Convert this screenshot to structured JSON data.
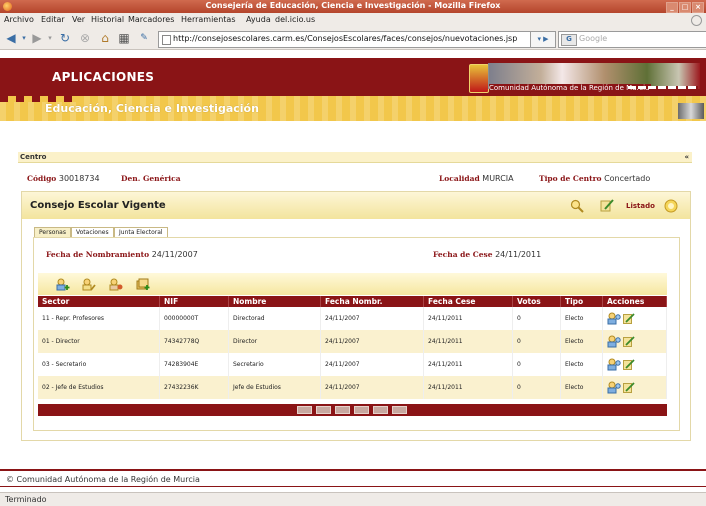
{
  "browser": {
    "title": "Consejería de Educación, Ciencia e Investigación - Mozilla Firefox",
    "menu": [
      "Archivo",
      "Editar",
      "Ver",
      "Historial",
      "Marcadores",
      "Herramientas",
      "Ayuda",
      "del.icio.us"
    ],
    "url": "http://consejosescolares.carm.es/ConsejosEscolares/faces/consejos/nuevotaciones.jsp",
    "search_placeholder": "Google",
    "search_engine": "G",
    "status": "Terminado"
  },
  "header": {
    "apps_label": "APLICACIONES",
    "region_label": "Comunidad Autónoma de la Región de Murcia",
    "section_title": "Educación, Ciencia e Investigación"
  },
  "centro": {
    "label": "Centro",
    "collapse": "«",
    "codigo_label": "Código",
    "codigo": "30018734",
    "den_label": "Den. Genérica",
    "den": "",
    "localidad_label": "Localidad",
    "localidad": "MURCIA",
    "tipo_label": "Tipo de Centro",
    "tipo": "Concertado"
  },
  "consejo": {
    "title": "Consejo Escolar Vigente",
    "listado": "Listado",
    "tabs": [
      "Personas",
      "Votaciones",
      "Junta Electoral"
    ],
    "nombramiento_label": "Fecha de Nombramiento",
    "nombramiento": "24/11/2007",
    "cese_label": "Fecha de Cese",
    "cese": "24/11/2011"
  },
  "table": {
    "headers": [
      "Sector",
      "NIF",
      "Nombre",
      "Fecha Nombr.",
      "Fecha Cese",
      "Votos",
      "Tipo",
      "Acciones"
    ],
    "rows": [
      {
        "sector": "11 - Repr. Profesores",
        "nif": "00000000T",
        "nombre": "Directorad",
        "nombr": "24/11/2007",
        "cese": "24/11/2011",
        "votos": "0",
        "tipo": "Electo"
      },
      {
        "sector": "01 - Director",
        "nif": "74342778Q",
        "nombre": "Director",
        "nombr": "24/11/2007",
        "cese": "24/11/2011",
        "votos": "0",
        "tipo": "Electo"
      },
      {
        "sector": "03 - Secretario",
        "nif": "74283904E",
        "nombre": "Secretario",
        "nombr": "24/11/2007",
        "cese": "24/11/2011",
        "votos": "0",
        "tipo": "Electo"
      },
      {
        "sector": "02 - Jefe de Estudios",
        "nif": "27432236K",
        "nombre": "Jefe de Estudios",
        "nombr": "24/11/2007",
        "cese": "24/11/2011",
        "votos": "0",
        "tipo": "Electo"
      }
    ]
  },
  "footer": {
    "copyright": "© Comunidad Autónoma de la Región de Murcia"
  },
  "colors": {
    "brand_red": "#8a1416",
    "brand_gold": "#f2c74b",
    "panel_cream": "#faf1cf"
  }
}
